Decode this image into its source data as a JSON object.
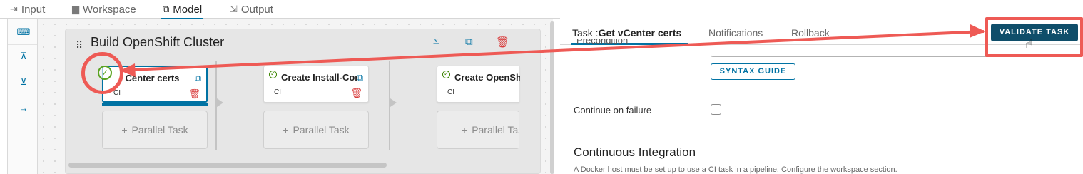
{
  "top_tabs": [
    {
      "label": "Input",
      "icon": "input-icon"
    },
    {
      "label": "Workspace",
      "icon": "workspace-icon"
    },
    {
      "label": "Model",
      "icon": "model-icon",
      "active": true
    },
    {
      "label": "Output",
      "icon": "output-icon"
    }
  ],
  "rail": {
    "icons": [
      "keyboard-icon",
      "collapse-up-icon",
      "collapse-down-icon",
      "arrow-right-icon"
    ]
  },
  "stage": {
    "title": "Build OpenShift Cluster"
  },
  "tasks": [
    {
      "name": "Get vCenter certs",
      "name_visible": "Get vCenter certs",
      "type": "CI",
      "selected": true
    },
    {
      "name": "Create Install-Conf",
      "type": "CI",
      "selected": false
    },
    {
      "name": "Create OpenShift",
      "type": "CI",
      "selected": false
    }
  ],
  "parallel_label": "Parallel Task",
  "panel": {
    "tabs": [
      {
        "prefix": "Task :",
        "label": "Get vCenter certs",
        "active": true
      },
      {
        "label": "Notifications"
      },
      {
        "label": "Rollback"
      }
    ],
    "cut_label": "Precondition",
    "syntax_guide": "SYNTAX GUIDE",
    "continue_on_failure": "Continue on failure",
    "continue_checked": false,
    "section_title": "Continuous Integration",
    "help_text": "A Docker host must be set up to use a CI task in a pipeline. Configure the workspace section.",
    "validate_button": "VALIDATE TASK"
  },
  "colors": {
    "accent": "#0072a3",
    "primary_button": "#0f4e6a",
    "annotation": "#ee5a55",
    "success": "#3c8500",
    "danger": "#d93e3e"
  }
}
